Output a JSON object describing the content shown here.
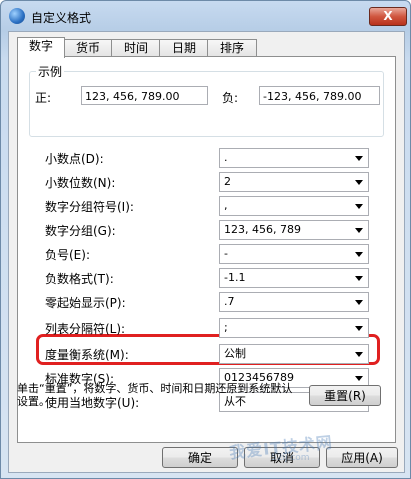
{
  "window": {
    "title": "自定义格式",
    "close_label": "X"
  },
  "tabs": [
    {
      "label": "数字",
      "active": true
    },
    {
      "label": "货币",
      "active": false
    },
    {
      "label": "时间",
      "active": false
    },
    {
      "label": "日期",
      "active": false
    },
    {
      "label": "排序",
      "active": false
    }
  ],
  "sample": {
    "legend": "示例",
    "positive_label": "正:",
    "positive_value": "123, 456, 789.00",
    "negative_label": "负:",
    "negative_value": "-123, 456, 789.00"
  },
  "settings": [
    {
      "label": "小数点(D):",
      "value": "."
    },
    {
      "label": "小数位数(N):",
      "value": "2"
    },
    {
      "label": "数字分组符号(I):",
      "value": ","
    },
    {
      "label": "数字分组(G):",
      "value": "123, 456, 789"
    },
    {
      "label": "负号(E):",
      "value": "-"
    },
    {
      "label": "负数格式(T):",
      "value": "-1.1"
    },
    {
      "label": "零起始显示(P):",
      "value": ".7"
    },
    {
      "label": "列表分隔符(L):",
      "value": ";"
    },
    {
      "label": "度量衡系统(M):",
      "value": "公制"
    },
    {
      "label": "标准数字(S):",
      "value": "0123456789"
    },
    {
      "label": "使用当地数字(U):",
      "value": "从不"
    }
  ],
  "note": "单击“重置”，将数字、货币、时间和日期还原到系统默认设置。",
  "buttons": {
    "reset": "重置(R)",
    "ok": "确定",
    "cancel": "取消",
    "apply": "应用(A)"
  },
  "watermark": {
    "text": "我爱IT技术网",
    "sub": "52ij.com"
  },
  "colors": {
    "highlight": "#e02020",
    "title_bar": "#c7daf0",
    "close": "#c9432b"
  }
}
